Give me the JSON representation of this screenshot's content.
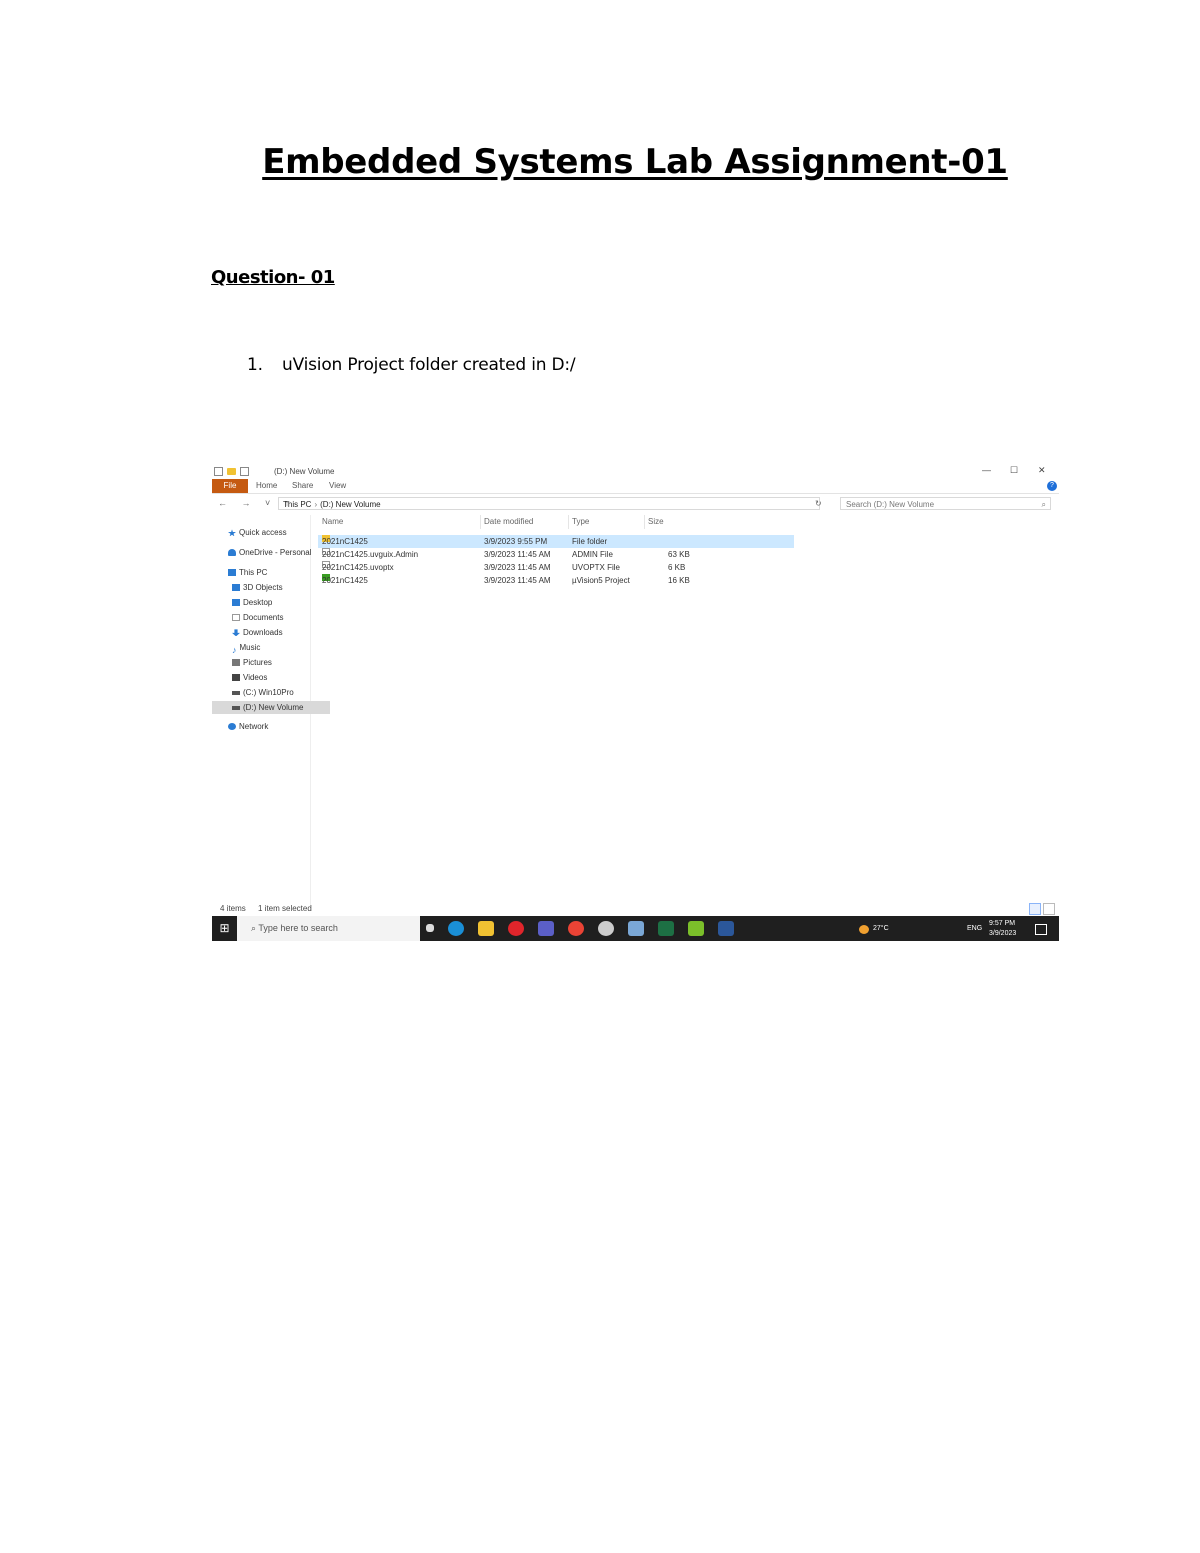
{
  "document": {
    "title": "Embedded Systems Lab Assignment-01",
    "question_heading": "Question- 01",
    "list": [
      {
        "number": "1.",
        "text": "uVision Project folder created in D:/"
      }
    ]
  },
  "explorer": {
    "window_title": "(D:) New Volume",
    "controls": {
      "minimize": "—",
      "maximize": "☐",
      "close": "✕"
    },
    "ribbon_tabs": [
      "File",
      "Home",
      "Share",
      "View"
    ],
    "help_icon": "?",
    "nav_arrows": "← → ˅ ↑",
    "breadcrumb": [
      "This PC",
      "(D:) New Volume"
    ],
    "search_placeholder": "Search (D:) New Volume",
    "nav_pane": [
      {
        "label": "Quick access",
        "icon": "star-icon",
        "color": "#2b7cd3"
      },
      {
        "label": "OneDrive - Personal",
        "icon": "cloud-icon",
        "color": "#2b7cd3"
      },
      {
        "label": "This PC",
        "icon": "pc-icon",
        "color": "#2b7cd3"
      },
      {
        "label": "3D Objects",
        "icon": "cube-icon",
        "color": "#2b7cd3"
      },
      {
        "label": "Desktop",
        "icon": "desktop-icon",
        "color": "#2b7cd3"
      },
      {
        "label": "Documents",
        "icon": "documents-icon",
        "color": "#999999"
      },
      {
        "label": "Downloads",
        "icon": "download-icon",
        "color": "#2b7cd3"
      },
      {
        "label": "Music",
        "icon": "music-icon",
        "color": "#2b7cd3"
      },
      {
        "label": "Pictures",
        "icon": "pictures-icon",
        "color": "#777777"
      },
      {
        "label": "Videos",
        "icon": "videos-icon",
        "color": "#444444"
      },
      {
        "label": "(C:) Win10Pro",
        "icon": "drive-icon",
        "color": "#555555"
      },
      {
        "label": "(D:) New Volume",
        "icon": "drive-icon",
        "color": "#555555",
        "selected": true
      },
      {
        "label": "Network",
        "icon": "network-icon",
        "color": "#2b7cd3"
      }
    ],
    "columns": [
      "Name",
      "Date modified",
      "Type",
      "Size"
    ],
    "files": [
      {
        "name": "2021nC1425",
        "date": "3/9/2023 9:55 PM",
        "type": "File folder",
        "size": "",
        "icon": "folder-icon",
        "color": "#f1c232",
        "selected": true
      },
      {
        "name": "2021nC1425.uvguix.Admin",
        "date": "3/9/2023 11:45 AM",
        "type": "ADMIN File",
        "size": "63 KB",
        "icon": "file-icon",
        "color": "#ffffff"
      },
      {
        "name": "2021nC1425.uvoptx",
        "date": "3/9/2023 11:45 AM",
        "type": "UVOPTX File",
        "size": "6 KB",
        "icon": "file-icon",
        "color": "#ffffff"
      },
      {
        "name": "2021nC1425",
        "date": "3/9/2023 11:45 AM",
        "type": "µVision5 Project",
        "size": "16 KB",
        "icon": "uvision-project-icon",
        "color": "#3a9d23"
      }
    ],
    "status": {
      "items": "4 items",
      "selected": "1 item selected"
    },
    "taskbar": {
      "search_placeholder": "Type here to search",
      "apps": [
        {
          "icon": "task-view-icon",
          "color": "#dddddd"
        },
        {
          "icon": "edge-icon",
          "color": "#1a8fd6"
        },
        {
          "icon": "file-explorer-icon",
          "color": "#f1c232"
        },
        {
          "icon": "opera-icon",
          "color": "#e0252b"
        },
        {
          "icon": "teams-icon",
          "color": "#5b5fc7"
        },
        {
          "icon": "chrome-icon",
          "color": "#ea4335"
        },
        {
          "icon": "settings-icon",
          "color": "#cccccc"
        },
        {
          "icon": "app-icon",
          "color": "#7aa7d6"
        },
        {
          "icon": "excel-icon",
          "color": "#1d7044"
        },
        {
          "icon": "keil-icon",
          "color": "#7bbf2a"
        },
        {
          "icon": "word-icon",
          "color": "#2b579a"
        }
      ],
      "weather": "27°C",
      "lang": "ENG",
      "time": "9:57 PM",
      "date": "3/9/2023"
    }
  }
}
